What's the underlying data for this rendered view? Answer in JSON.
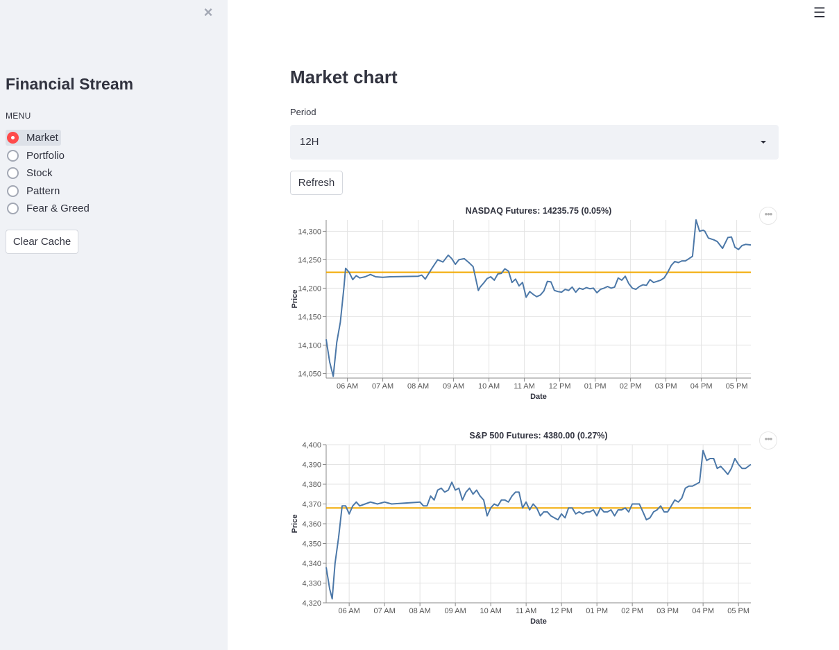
{
  "sidebar": {
    "close_icon": "×",
    "title": "Financial Stream",
    "menu_label": "MENU",
    "items": [
      {
        "label": "Market",
        "selected": true
      },
      {
        "label": "Portfolio",
        "selected": false
      },
      {
        "label": "Stock",
        "selected": false
      },
      {
        "label": "Pattern",
        "selected": false
      },
      {
        "label": "Fear & Greed",
        "selected": false
      }
    ],
    "clear_cache_label": "Clear Cache"
  },
  "header": {
    "menu_icon": "☰"
  },
  "main": {
    "title": "Market chart",
    "period_label": "Period",
    "period_value": "12H",
    "refresh_label": "Refresh",
    "more_icon": "•••"
  },
  "colors": {
    "accent": "#ff4b4b",
    "line": "#4c78a8",
    "reference": "#f2a900",
    "sidebar_bg": "#f0f2f6"
  },
  "chart_data": [
    {
      "type": "line",
      "title": "NASDAQ Futures: 14235.75  (0.05%)",
      "xlabel": "Date",
      "ylabel": "Price",
      "xlim": [
        5.4,
        17.4
      ],
      "ylim": [
        14042,
        14320
      ],
      "x_ticks": [
        6,
        7,
        8,
        9,
        10,
        11,
        12,
        13,
        14,
        15,
        16,
        17
      ],
      "x_tick_labels": [
        "06 AM",
        "07 AM",
        "08 AM",
        "09 AM",
        "10 AM",
        "11 AM",
        "12 PM",
        "01 PM",
        "02 PM",
        "03 PM",
        "04 PM",
        "05 PM"
      ],
      "y_ticks": [
        14050,
        14100,
        14150,
        14200,
        14250,
        14300
      ],
      "y_tick_labels": [
        "14,050",
        "14,100",
        "14,150",
        "14,200",
        "14,250",
        "14,300"
      ],
      "grid": true,
      "reference_line": 14228,
      "series": [
        {
          "x": [
            5.4,
            5.5,
            5.6,
            5.7,
            5.8,
            5.9,
            5.95,
            6.05,
            6.15,
            6.25,
            6.35,
            6.5,
            6.65,
            6.8,
            7.0,
            7.2,
            8.0,
            8.1,
            8.2,
            8.3,
            8.4,
            8.55,
            8.7,
            8.85,
            8.95,
            9.05,
            9.15,
            9.3,
            9.45,
            9.55,
            9.7,
            9.75,
            9.85,
            9.95,
            10.05,
            10.15,
            10.25,
            10.35,
            10.45,
            10.55,
            10.65,
            10.75,
            10.85,
            10.95,
            11.05,
            11.15,
            11.25,
            11.35,
            11.45,
            11.55,
            11.65,
            11.75,
            11.85,
            11.95,
            12.05,
            12.15,
            12.25,
            12.35,
            12.45,
            12.55,
            12.65,
            12.75,
            12.85,
            12.95,
            13.05,
            13.15,
            13.25,
            13.35,
            13.45,
            13.55,
            13.65,
            13.75,
            13.85,
            13.95,
            14.05,
            14.15,
            14.25,
            14.35,
            14.45,
            14.55,
            14.65,
            14.75,
            14.85,
            14.95,
            15.05,
            15.15,
            15.25,
            15.35,
            15.45,
            15.55,
            15.65,
            15.75,
            15.85,
            15.95,
            16.05,
            16.1,
            16.2,
            16.35,
            16.45,
            16.6,
            16.75,
            16.85,
            16.95,
            17.05,
            17.15,
            17.25,
            17.4
          ],
          "y": [
            14110,
            14070,
            14045,
            14105,
            14140,
            14200,
            14235,
            14228,
            14215,
            14222,
            14218,
            14220,
            14224,
            14220,
            14219,
            14220,
            14221,
            14223,
            14216,
            14226,
            14236,
            14250,
            14246,
            14258,
            14252,
            14242,
            14250,
            14252,
            14244,
            14238,
            14196,
            14202,
            14209,
            14217,
            14220,
            14214,
            14225,
            14226,
            14234,
            14230,
            14210,
            14216,
            14204,
            14210,
            14184,
            14194,
            14189,
            14185,
            14188,
            14195,
            14212,
            14211,
            14196,
            14194,
            14193,
            14198,
            14196,
            14202,
            14193,
            14200,
            14198,
            14201,
            14199,
            14200,
            14192,
            14198,
            14200,
            14203,
            14200,
            14202,
            14218,
            14214,
            14221,
            14208,
            14200,
            14198,
            14203,
            14206,
            14205,
            14215,
            14210,
            14212,
            14214,
            14218,
            14228,
            14240,
            14247,
            14245,
            14248,
            14248,
            14252,
            14256,
            14320,
            14300,
            14302,
            14300,
            14288,
            14285,
            14282,
            14270,
            14289,
            14290,
            14272,
            14268,
            14275,
            14277,
            14276
          ]
        }
      ]
    },
    {
      "type": "line",
      "title": "S&P 500 Futures: 4380.00  (0.27%)",
      "xlabel": "Date",
      "ylabel": "Price",
      "xlim": [
        5.35,
        17.35
      ],
      "ylim": [
        4320,
        4400
      ],
      "x_ticks": [
        6,
        7,
        8,
        9,
        10,
        11,
        12,
        13,
        14,
        15,
        16,
        17
      ],
      "x_tick_labels": [
        "06 AM",
        "07 AM",
        "08 AM",
        "09 AM",
        "10 AM",
        "11 AM",
        "12 PM",
        "01 PM",
        "02 PM",
        "03 PM",
        "04 PM",
        "05 PM"
      ],
      "y_ticks": [
        4320,
        4330,
        4340,
        4350,
        4360,
        4370,
        4380,
        4390,
        4400
      ],
      "y_tick_labels": [
        "4,320",
        "4,330",
        "4,340",
        "4,350",
        "4,360",
        "4,370",
        "4,380",
        "4,390",
        "4,400"
      ],
      "grid": true,
      "reference_line": 4368,
      "series": [
        {
          "x": [
            5.35,
            5.45,
            5.52,
            5.6,
            5.7,
            5.8,
            5.9,
            6.0,
            6.1,
            6.2,
            6.3,
            6.45,
            6.6,
            6.8,
            7.0,
            7.2,
            8.0,
            8.1,
            8.2,
            8.3,
            8.4,
            8.5,
            8.6,
            8.7,
            8.8,
            8.9,
            9.0,
            9.1,
            9.2,
            9.3,
            9.4,
            9.5,
            9.6,
            9.7,
            9.8,
            9.9,
            10.0,
            10.1,
            10.2,
            10.3,
            10.4,
            10.5,
            10.6,
            10.7,
            10.8,
            10.9,
            11.0,
            11.1,
            11.2,
            11.3,
            11.4,
            11.5,
            11.6,
            11.7,
            11.8,
            11.9,
            12.0,
            12.1,
            12.2,
            12.3,
            12.4,
            12.5,
            12.6,
            12.7,
            12.8,
            12.9,
            13.0,
            13.1,
            13.2,
            13.3,
            13.4,
            13.5,
            13.6,
            13.7,
            13.8,
            13.9,
            14.0,
            14.1,
            14.2,
            14.3,
            14.4,
            14.5,
            14.6,
            14.7,
            14.8,
            14.9,
            15.0,
            15.1,
            15.2,
            15.3,
            15.4,
            15.5,
            15.6,
            15.7,
            15.8,
            15.9,
            16.0,
            16.1,
            16.2,
            16.3,
            16.4,
            16.5,
            16.6,
            16.7,
            16.8,
            16.9,
            17.0,
            17.1,
            17.2,
            17.35
          ],
          "y": [
            4338,
            4327,
            4322,
            4340,
            4353,
            4369,
            4369,
            4365,
            4369,
            4371,
            4369,
            4370,
            4371,
            4370,
            4371,
            4370,
            4371,
            4369,
            4369,
            4374,
            4372,
            4377,
            4378,
            4376,
            4377,
            4381,
            4377,
            4378,
            4372,
            4376,
            4378,
            4375,
            4377,
            4374,
            4372,
            4364,
            4368,
            4370,
            4369,
            4372,
            4372,
            4371,
            4374,
            4376,
            4376,
            4368,
            4371,
            4367,
            4370,
            4368,
            4364,
            4366,
            4366,
            4364,
            4363,
            4362,
            4365,
            4363,
            4368,
            4368,
            4365,
            4366,
            4365,
            4366,
            4366,
            4367,
            4364,
            4368,
            4366,
            4366,
            4367,
            4364,
            4367,
            4367,
            4368,
            4366,
            4370,
            4370,
            4370,
            4366,
            4362,
            4363,
            4366,
            4367,
            4369,
            4366,
            4366,
            4369,
            4372,
            4371,
            4373,
            4378,
            4379,
            4379,
            4380,
            4381,
            4397,
            4392,
            4393,
            4393,
            4388,
            4389,
            4387,
            4385,
            4388,
            4393,
            4390,
            4388,
            4388,
            4390
          ]
        }
      ]
    }
  ]
}
